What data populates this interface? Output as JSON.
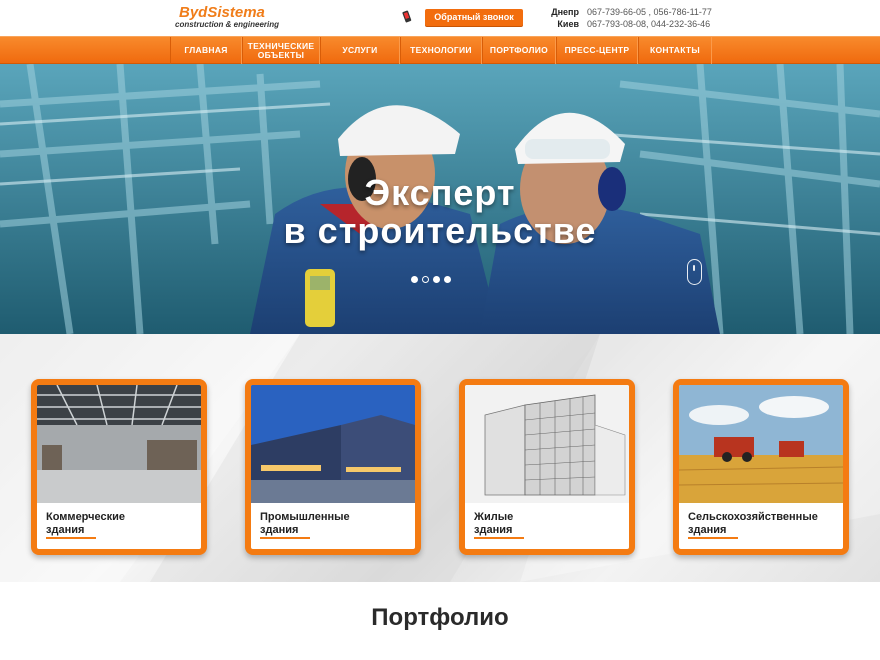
{
  "header": {
    "logo_main": "BydSistema",
    "logo_sub": "construction & engineering",
    "callback_label": "Обратный звонок",
    "contacts": [
      {
        "city": "Днепр",
        "phones": "067-739-66-05 , 056-786-11-77"
      },
      {
        "city": "Киев",
        "phones": "067-793-08-08,  044-232-36-46"
      }
    ]
  },
  "nav": {
    "items": [
      "Главная",
      "Технические объекты",
      "Услуги",
      "Технологии",
      "Портфолио",
      "Пресс-центр",
      "Контакты"
    ]
  },
  "hero": {
    "title_line1": "Эксперт",
    "title_line2": "в строительстве",
    "slide_count": 4,
    "active_slide": 2
  },
  "categories": [
    {
      "label_line1": "Коммерческие",
      "label_line2": "здания",
      "image": "warehouse-interior"
    },
    {
      "label_line1": "Промышленные",
      "label_line2": "здания",
      "image": "industrial-building"
    },
    {
      "label_line1": "Жилые",
      "label_line2": "здания",
      "image": "residential-3d-model"
    },
    {
      "label_line1": "Сельскохозяйственные",
      "label_line2": "здания",
      "image": "combine-harvester-field"
    }
  ],
  "portfolio": {
    "heading": "Портфолио"
  },
  "colors": {
    "accent": "#f47b12",
    "nav_top": "#f88a2c",
    "nav_bottom": "#f06a0e",
    "hero_blue": "#2c7a92"
  }
}
